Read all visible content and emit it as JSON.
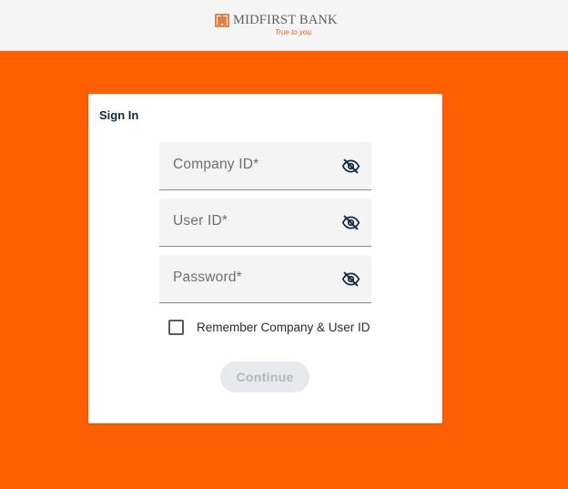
{
  "header": {
    "brand_name": "MIDFIRST BANK",
    "tagline": "True to you.",
    "logo_icon": "midfirst-logo-icon"
  },
  "signin": {
    "title": "Sign In",
    "fields": [
      {
        "label": "Company ID*",
        "value": "",
        "icon": "eye-off-icon"
      },
      {
        "label": "User ID*",
        "value": "",
        "icon": "eye-off-icon"
      },
      {
        "label": "Password*",
        "value": "",
        "icon": "eye-off-icon"
      }
    ],
    "remember_label": "Remember Company & User ID",
    "remember_checked": false,
    "continue_label": "Continue",
    "continue_enabled": false
  },
  "colors": {
    "brand_orange": "#ff5f00",
    "header_bg": "#f5f5f5",
    "title_navy": "#102a3c",
    "field_bg": "#f4f4f4",
    "button_disabled_bg": "#e7e9ec",
    "button_disabled_text": "#b3b8bf"
  }
}
